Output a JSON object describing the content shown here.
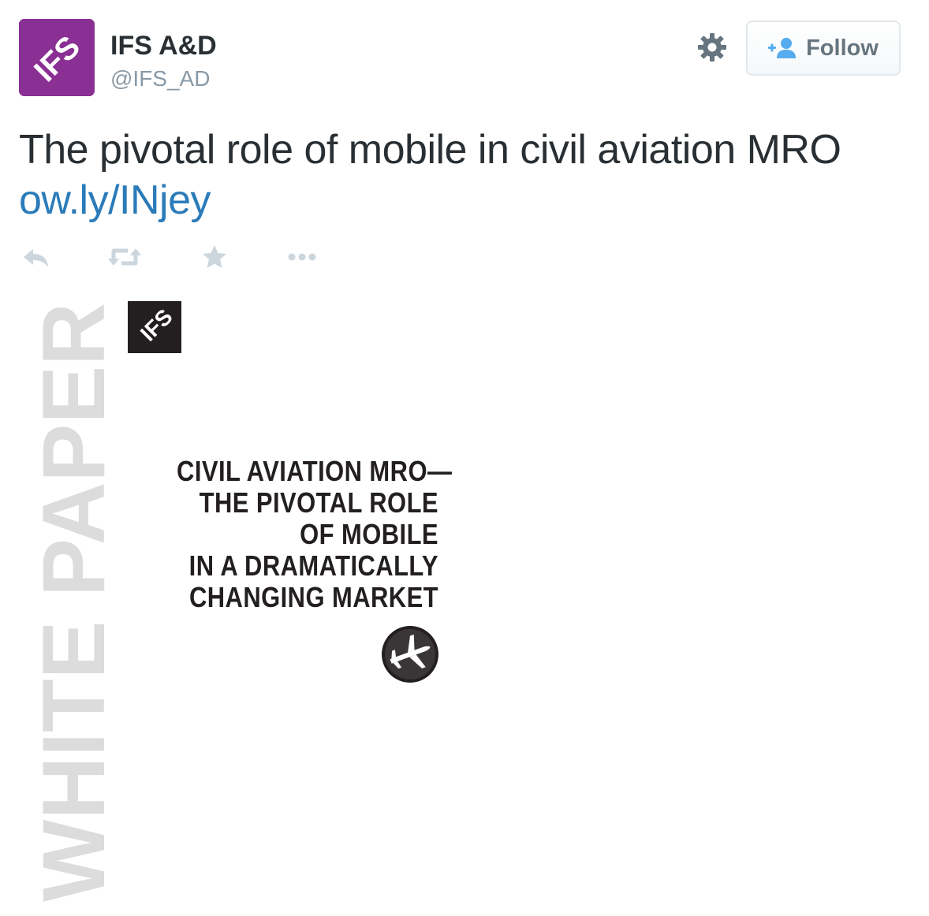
{
  "account": {
    "display_name": "IFS A&D",
    "screen_name": "@IFS_AD",
    "avatar_logo_text": "IFS"
  },
  "actions": {
    "follow_label": "Follow",
    "icons": [
      "settings-gear-icon",
      "add-user-icon",
      "reply-icon",
      "retweet-icon",
      "favorite-star-icon",
      "more-dots-icon"
    ]
  },
  "tweet": {
    "text": "The pivotal role of mobile in civil aviation MRO ",
    "link": "ow.ly/INjey"
  },
  "media": {
    "side_label": "WHITE PAPER",
    "logo_text": "IFS",
    "title_lines": [
      "CIVIL AVIATION MRO—",
      "THE PIVOTAL ROLE",
      "OF MOBILE",
      "IN A DRAMATICALLY",
      "CHANGING MARKET"
    ],
    "badge_icon": "airplane-icon"
  },
  "colors": {
    "brand_purple": "#8a2f93",
    "link_blue": "#2b7bb9",
    "text_dark": "#292f33",
    "text_muted": "#8899a6",
    "action_gray": "#ccd6dd",
    "follow_icon_blue": "#55acee"
  }
}
